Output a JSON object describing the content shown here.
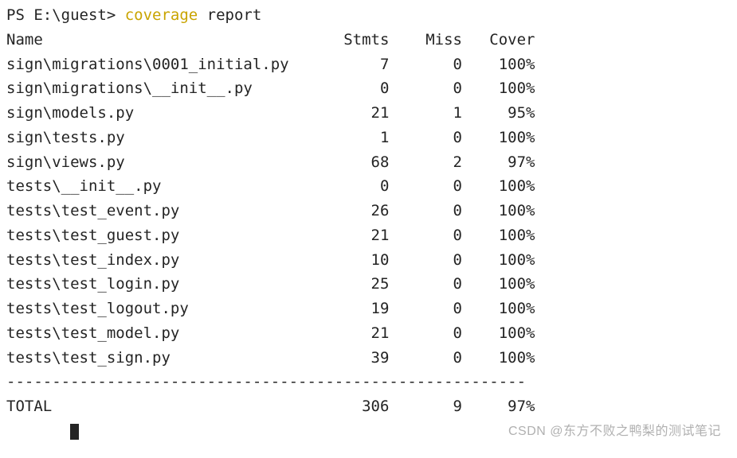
{
  "prompt": {
    "prefix": "PS E:\\guest> ",
    "command": "coverage",
    "args": " report"
  },
  "header": {
    "name": "Name",
    "stmts": "Stmts",
    "miss": "Miss",
    "cover": "Cover"
  },
  "rows": [
    {
      "name": "sign\\migrations\\0001_initial.py",
      "stmts": "7",
      "miss": "0",
      "cover": "100%"
    },
    {
      "name": "sign\\migrations\\__init__.py",
      "stmts": "0",
      "miss": "0",
      "cover": "100%"
    },
    {
      "name": "sign\\models.py",
      "stmts": "21",
      "miss": "1",
      "cover": "95%"
    },
    {
      "name": "sign\\tests.py",
      "stmts": "1",
      "miss": "0",
      "cover": "100%"
    },
    {
      "name": "sign\\views.py",
      "stmts": "68",
      "miss": "2",
      "cover": "97%"
    },
    {
      "name": "tests\\__init__.py",
      "stmts": "0",
      "miss": "0",
      "cover": "100%"
    },
    {
      "name": "tests\\test_event.py",
      "stmts": "26",
      "miss": "0",
      "cover": "100%"
    },
    {
      "name": "tests\\test_guest.py",
      "stmts": "21",
      "miss": "0",
      "cover": "100%"
    },
    {
      "name": "tests\\test_index.py",
      "stmts": "10",
      "miss": "0",
      "cover": "100%"
    },
    {
      "name": "tests\\test_login.py",
      "stmts": "25",
      "miss": "0",
      "cover": "100%"
    },
    {
      "name": "tests\\test_logout.py",
      "stmts": "19",
      "miss": "0",
      "cover": "100%"
    },
    {
      "name": "tests\\test_model.py",
      "stmts": "21",
      "miss": "0",
      "cover": "100%"
    },
    {
      "name": "tests\\test_sign.py",
      "stmts": "39",
      "miss": "0",
      "cover": "100%"
    }
  ],
  "divider": "---------------------------------------------------------",
  "total": {
    "name": "TOTAL",
    "stmts": "306",
    "miss": "9",
    "cover": "97%"
  },
  "watermark": "CSDN @东方不败之鸭梨的测试笔记",
  "layout": {
    "nameWidth": 34,
    "stmtsWidth": 8,
    "missWidth": 8,
    "coverWidth": 8
  }
}
